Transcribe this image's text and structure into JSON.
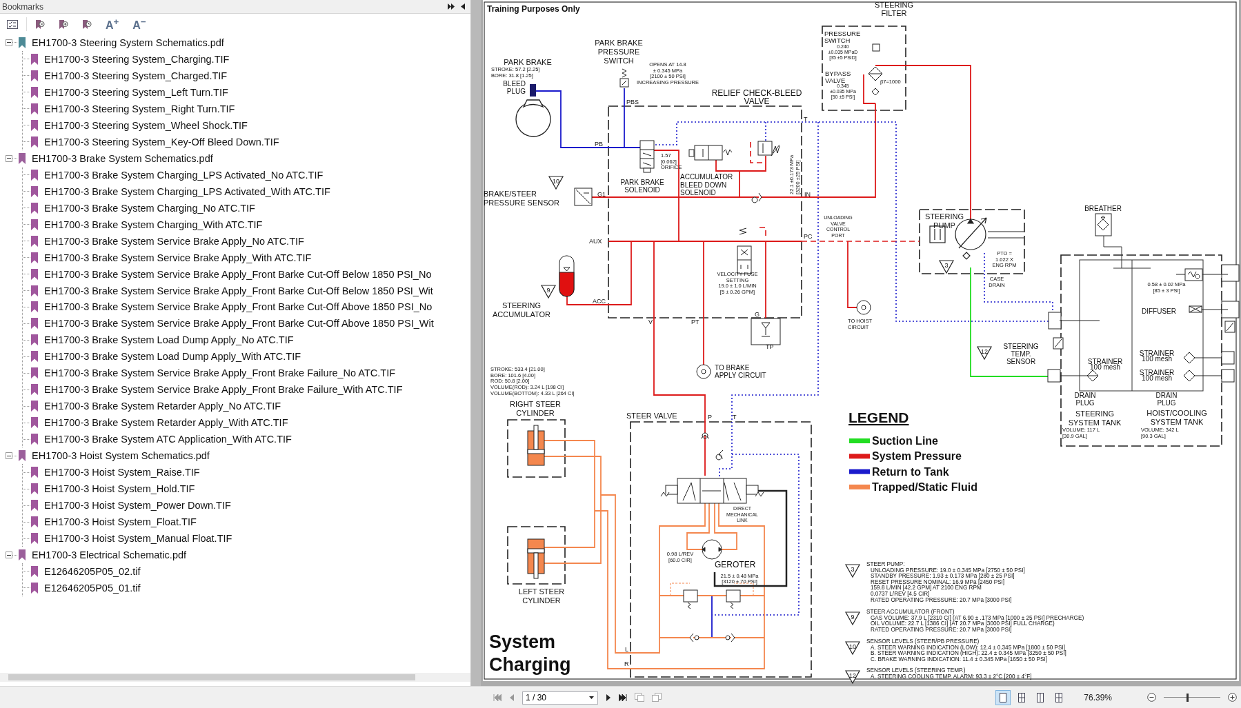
{
  "bookmarks_panel": {
    "title": "Bookmarks",
    "font_buttons": [
      "A$^{+}$",
      "A$^{−}$"
    ],
    "tree": [
      {
        "label": "EH1700-3 Steering System Schematics.pdf",
        "expanded": true,
        "current": true,
        "children": [
          {
            "label": "EH1700-3 Steering System_Charging.TIF"
          },
          {
            "label": "EH1700-3 Steering System_Charged.TIF"
          },
          {
            "label": "EH1700-3 Steering System_Left Turn.TIF"
          },
          {
            "label": "EH1700-3 Steering System_Right Turn.TIF"
          },
          {
            "label": "EH1700-3 Steering System_Wheel Shock.TIF"
          },
          {
            "label": "EH1700-3 Steering System_Key-Off Bleed Down.TIF"
          }
        ]
      },
      {
        "label": "EH1700-3 Brake System Schematics.pdf",
        "expanded": true,
        "current": false,
        "children": [
          {
            "label": "EH1700-3 Brake System Charging_LPS Activated_No ATC.TIF"
          },
          {
            "label": "EH1700-3 Brake System Charging_LPS Activated_With ATC.TIF"
          },
          {
            "label": "EH1700-3 Brake System Charging_No ATC.TIF"
          },
          {
            "label": "EH1700-3 Brake System Charging_With ATC.TIF"
          },
          {
            "label": "EH1700-3 Brake System Service Brake Apply_No ATC.TIF"
          },
          {
            "label": "EH1700-3 Brake System Service Brake Apply_With ATC.TIF"
          },
          {
            "label": "EH1700-3 Brake System Service Brake Apply_Front Barke Cut-Off Below 1850 PSI_No"
          },
          {
            "label": "EH1700-3 Brake System Service Brake Apply_Front Barke Cut-Off Below 1850 PSI_Wit"
          },
          {
            "label": "EH1700-3 Brake System Service Brake Apply_Front Barke Cut-Off Above 1850 PSI_No"
          },
          {
            "label": "EH1700-3 Brake System Service Brake Apply_Front Barke Cut-Off Above 1850 PSI_Wit"
          },
          {
            "label": "EH1700-3 Brake System Load Dump Apply_No ATC.TIF"
          },
          {
            "label": "EH1700-3 Brake System Load Dump Apply_With ATC.TIF"
          },
          {
            "label": "EH1700-3 Brake System Service Brake Apply_Front Brake Failure_No ATC.TIF"
          },
          {
            "label": "EH1700-3 Brake System Service Brake Apply_Front Brake Failure_With ATC.TIF"
          },
          {
            "label": "EH1700-3 Brake System Retarder Apply_No ATC.TIF"
          },
          {
            "label": "EH1700-3 Brake System Retarder Apply_With ATC.TIF"
          },
          {
            "label": "EH1700-3 Brake System ATC Application_With ATC.TIF"
          }
        ]
      },
      {
        "label": "EH1700-3 Hoist System Schematics.pdf",
        "expanded": true,
        "current": false,
        "children": [
          {
            "label": "EH1700-3 Hoist System_Raise.TIF"
          },
          {
            "label": "EH1700-3 Hoist System_Hold.TIF"
          },
          {
            "label": "EH1700-3 Hoist System_Power Down.TIF"
          },
          {
            "label": "EH1700-3 Hoist System_Float.TIF"
          },
          {
            "label": "EH1700-3 Hoist System_Manual Float.TIF"
          }
        ]
      },
      {
        "label": "EH1700-3 Electrical Schematic.pdf",
        "expanded": true,
        "current": false,
        "children": [
          {
            "label": "E12646205P05_02.tif"
          },
          {
            "label": "E12646205P05_01.tif"
          }
        ]
      }
    ]
  },
  "page": {
    "notice": "Training Purposes Only",
    "labels": [
      {
        "kind": "text",
        "lines": [
          "PARK BRAKE"
        ]
      },
      {
        "kind": "text",
        "lines": [
          "STROKE: 57.2 [2.25]",
          "BORE: 31.8 [1.25]"
        ]
      },
      {
        "kind": "text",
        "lines": [
          "BLEED",
          "PLUG"
        ]
      },
      {
        "kind": "text",
        "lines": [
          "PARK BRAKE",
          "PRESSURE",
          "SWITCH"
        ]
      },
      {
        "kind": "text",
        "lines": [
          "OPENS AT 14.8",
          "± 0.345 MPa",
          "[2100 ± 50 PSI]",
          "INCREASING PRESSURE"
        ]
      },
      {
        "kind": "port",
        "lines": [
          "PBS"
        ]
      },
      {
        "kind": "text",
        "lines": [
          "RELIEF CHECK-BLEED",
          "VALVE"
        ]
      },
      {
        "kind": "port",
        "lines": [
          "PB"
        ]
      },
      {
        "kind": "port",
        "lines": [
          "T"
        ]
      },
      {
        "kind": "text",
        "lines": [
          "1.57",
          "[0.062]",
          "ORIFICE"
        ]
      },
      {
        "kind": "marker",
        "lines": [
          "10"
        ]
      },
      {
        "kind": "text",
        "lines": [
          "BRAKE/STEER",
          "PRESSURE SENSOR"
        ]
      },
      {
        "kind": "port",
        "lines": [
          "G1"
        ]
      },
      {
        "kind": "text",
        "lines": [
          "PARK BRAKE",
          "SOLENOID"
        ]
      },
      {
        "kind": "text",
        "lines": [
          "ACCUMULATOR",
          "BLEED DOWN",
          "SOLENOID"
        ]
      },
      {
        "kind": "text",
        "lines": [
          "22.1 ±0.173 MPa",
          "[3200 ±25 PSI]"
        ]
      },
      {
        "kind": "port",
        "lines": [
          "IN"
        ]
      },
      {
        "kind": "text",
        "lines": [
          "UNLOADING",
          "VALVE",
          "CONTROL",
          "PORT"
        ]
      },
      {
        "kind": "port",
        "lines": [
          "AUX"
        ]
      },
      {
        "kind": "port",
        "lines": [
          "PC"
        ]
      },
      {
        "kind": "text",
        "lines": [
          "VELOCITY FUSE",
          "SETTING",
          "19.0 ± 1.0 L/MIN",
          "[5 ± 0.26 GPM]"
        ]
      },
      {
        "kind": "marker",
        "lines": [
          "9"
        ]
      },
      {
        "kind": "text",
        "lines": [
          "STEERING",
          "ACCUMULATOR"
        ]
      },
      {
        "kind": "port",
        "lines": [
          "ACC"
        ]
      },
      {
        "kind": "port",
        "lines": [
          "V"
        ]
      },
      {
        "kind": "port",
        "lines": [
          "PT"
        ]
      },
      {
        "kind": "port",
        "lines": [
          "G"
        ]
      },
      {
        "kind": "port",
        "lines": [
          "TP"
        ]
      },
      {
        "kind": "text",
        "lines": [
          "TO HOIST",
          "CIRCUIT"
        ]
      },
      {
        "kind": "text",
        "lines": [
          "STEERING",
          "FILTER"
        ]
      },
      {
        "kind": "text",
        "lines": [
          "PRESSURE",
          "SWITCH"
        ]
      },
      {
        "kind": "text",
        "lines": [
          "0.240",
          "±0.035 MPaD",
          "[35 ±5 PSID]"
        ]
      },
      {
        "kind": "text",
        "lines": [
          "BYPASS",
          "VALVE"
        ]
      },
      {
        "kind": "text",
        "lines": [
          "0.345",
          "±0.035 MPa",
          "[50 ±5 PSI]"
        ]
      },
      {
        "kind": "text",
        "lines": [
          "β7=1000"
        ]
      },
      {
        "kind": "text",
        "lines": [
          "STEERING",
          "PUMP"
        ]
      },
      {
        "kind": "marker",
        "lines": [
          "3"
        ]
      },
      {
        "kind": "text",
        "lines": [
          "PTO =",
          "1.022 X",
          "ENG RPM"
        ]
      },
      {
        "kind": "text",
        "lines": [
          "CASE",
          "DRAIN"
        ]
      },
      {
        "kind": "text",
        "lines": [
          "BREATHER"
        ]
      },
      {
        "kind": "text",
        "lines": [
          "0.58 ± 0.02 MPa",
          "[85 ± 3 PSI]"
        ]
      },
      {
        "kind": "text",
        "lines": [
          "DIFFUSER"
        ]
      },
      {
        "kind": "marker",
        "lines": [
          "12"
        ]
      },
      {
        "kind": "text",
        "lines": [
          "STEERING",
          "TEMP.",
          "SENSOR"
        ]
      },
      {
        "kind": "text",
        "lines": [
          "STRAINER",
          "100 mesh"
        ]
      },
      {
        "kind": "text",
        "lines": [
          "STRAINER",
          "100 mesh"
        ]
      },
      {
        "kind": "text",
        "lines": [
          "STRAINER",
          "100 mesh"
        ]
      },
      {
        "kind": "text",
        "lines": [
          "DRAIN",
          "PLUG"
        ]
      },
      {
        "kind": "text",
        "lines": [
          "DRAIN",
          "PLUG"
        ]
      },
      {
        "kind": "text",
        "lines": [
          "STEERING",
          "SYSTEM TANK"
        ]
      },
      {
        "kind": "text",
        "lines": [
          "VOLUME: 117 L",
          "[30.9 GAL]"
        ]
      },
      {
        "kind": "text",
        "lines": [
          "HOIST/COOLING",
          "SYSTEM TANK"
        ]
      },
      {
        "kind": "text",
        "lines": [
          "VOLUME: 342 L",
          "[90.3 GAL]"
        ]
      },
      {
        "kind": "text",
        "lines": [
          "STROKE: 533.4 [21.00]",
          "BORE: 101.6 [4.00]",
          "ROD: 50.8 [2.00]",
          "VOLUME(ROD): 3.24 L [198 CI]",
          "VOLUME(BOTTOM): 4.33 L [264 CI]"
        ]
      },
      {
        "kind": "text",
        "lines": [
          "RIGHT STEER",
          "CYLINDER"
        ]
      },
      {
        "kind": "text",
        "lines": [
          "TO BRAKE",
          "APPLY CIRCUIT"
        ]
      },
      {
        "kind": "text",
        "lines": [
          "STEER VALVE"
        ]
      },
      {
        "kind": "port",
        "lines": [
          "P"
        ]
      },
      {
        "kind": "port",
        "lines": [
          "T"
        ]
      },
      {
        "kind": "text",
        "lines": [
          "DIRECT",
          "MECHANICAL",
          "LINK"
        ]
      },
      {
        "kind": "text",
        "lines": [
          "0.98 L/REV",
          "[60.0 CIR]"
        ]
      },
      {
        "kind": "text",
        "lines": [
          "GEROTER"
        ]
      },
      {
        "kind": "text",
        "lines": [
          "21.5 ± 0.48 MPa",
          "[3120 ± 70 PSI]"
        ]
      },
      {
        "kind": "text",
        "lines": [
          "LEFT STEER",
          "CYLINDER"
        ]
      },
      {
        "kind": "port",
        "lines": [
          "L"
        ]
      },
      {
        "kind": "port",
        "lines": [
          "R"
        ]
      }
    ],
    "legend": {
      "title": "LEGEND",
      "items": [
        {
          "label": "Suction Line",
          "color": "#22dd22"
        },
        {
          "label": "System Pressure",
          "color": "#dd1a1a"
        },
        {
          "label": "Return to Tank",
          "color": "#1a1acc"
        },
        {
          "label": "Trapped/Static Fluid",
          "color": "#f4874e"
        }
      ]
    },
    "notes": [
      {
        "marker": "3",
        "heading": "STEER PUMP:",
        "lines": [
          "UNLOADING PRESSURE: 19.0 ± 0.345 MPa [2750 ± 50 PSI]",
          "STANDBY PRESSURE: 1.93 ± 0.173 MPa [280 ± 25 PSI]",
          "RESET PRESSURE NOMINAL: 16.9 MPa [2450 PSI]",
          "159.8 L/MIN [42.2 GPM] AT 2100 ENG RPM",
          "0.0737 L/REV [4.5 CIR]",
          "RATED OPERATING PRESSURE: 20.7 MPa [3000 PSI]"
        ]
      },
      {
        "marker": "9",
        "heading": "STEER ACCUMULATOR (FRONT)",
        "lines": [
          "GAS VOLUME: 37.9 L [2310 CI] (AT 6.90 ± .173 MPa [1000 ± 25 PSI] PRECHARGE)",
          "OIL VOLUME: 22.7 L [1386 CI] (AT 20.7 MPa [3000 PSI] FULL CHARGE)",
          "RATED OPERATING PRESSURE: 20.7 MPa [3000 PSI]"
        ]
      },
      {
        "marker": "10",
        "heading": "SENSOR LEVELS (STEER/PB PRESSURE)",
        "lines": [
          "A. STEER WARNING INDICATION (LOW): 12.4 ± 0.345 MPa [1800 ± 50 PSI]",
          "B. STEER WARNING INDICATION (HIGH): 22.4 ± 0.345 MPa [3250 ± 50 PSI]",
          "C. BRAKE WARNING INDICATION: 11.4 ± 0.345 MPa [1650 ± 50 PSI]"
        ]
      },
      {
        "marker": "12",
        "heading": "SENSOR LEVELS (STEERING TEMP.)",
        "lines": [
          "A. STEERING COOLING TEMP. ALARM: 93.3 ± 2°C [200 ± 4°F]"
        ]
      }
    ],
    "title_lines": [
      "System",
      "Charging"
    ]
  },
  "toolbar": {
    "page_field": "1 / 30",
    "view_modes": [
      {
        "selected": true
      },
      {
        "selected": false
      },
      {
        "selected": false
      },
      {
        "selected": false
      }
    ],
    "zoom": "76.39%",
    "zoom_slider": {
      "level": 0.42
    }
  }
}
